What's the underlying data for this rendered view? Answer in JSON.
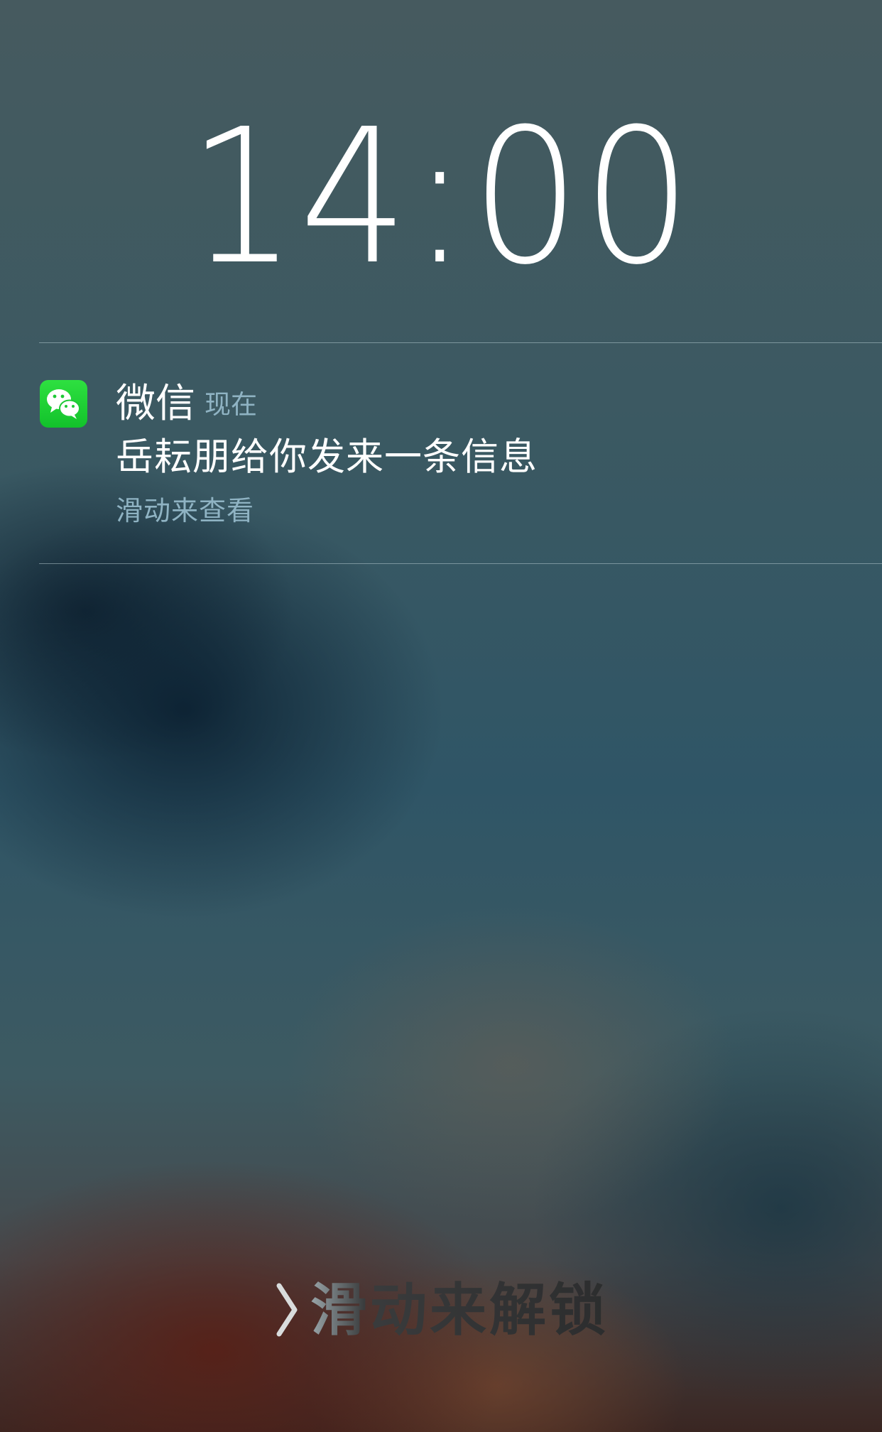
{
  "lock_screen": {
    "time": "14:00",
    "unlock_label": "滑动来解锁"
  },
  "notification": {
    "app_name": "微信",
    "timestamp": "现在",
    "message": "岳耘朋给你发来一条信息",
    "hint": "滑动来查看",
    "icon": "wechat-icon"
  },
  "colors": {
    "wechat_green": "#1fd03a",
    "secondary_text": "#8fb3c3",
    "primary_text": "#ffffff"
  }
}
